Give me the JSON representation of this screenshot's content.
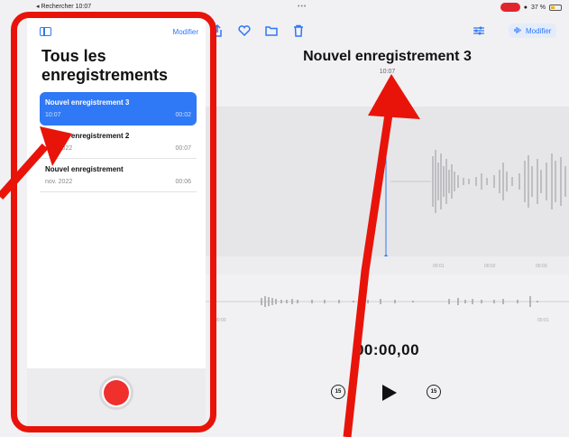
{
  "status": {
    "left_text": "◂ Rechercher  10:07",
    "center_dots": "•••",
    "battery_text": "37 %"
  },
  "sidebar": {
    "edit_label": "Modifier",
    "title": "Tous les enregistrements",
    "recordings": [
      {
        "name": "Nouvel enregistrement 3",
        "date": "10:07",
        "duration": "00:02",
        "selected": true
      },
      {
        "name": "Nouvel enregistrement 2",
        "date": "nov. 2022",
        "duration": "00:07",
        "selected": false
      },
      {
        "name": "Nouvel enregistrement",
        "date": "nov. 2022",
        "duration": "00:06",
        "selected": false
      }
    ]
  },
  "main": {
    "edit_label": "Modifier",
    "title": "Nouvel enregistrement 3",
    "time": "10:07",
    "ticks": [
      "00:01",
      "00:02",
      "00:03"
    ],
    "scrub_start": "00:00",
    "scrub_end": "00:01",
    "elapsed": "00:00,00",
    "skip_back": "15",
    "skip_forward": "15"
  },
  "colors": {
    "accent": "#2f78f6",
    "record": "#f0302d",
    "annotation": "#e8140a"
  },
  "icons": [
    "sidebar-toggle-icon",
    "share-icon",
    "heart-icon",
    "folder-icon",
    "trash-icon",
    "options-icon",
    "waveform-icon",
    "play-icon",
    "skip-back-15-icon",
    "skip-forward-15-icon"
  ]
}
